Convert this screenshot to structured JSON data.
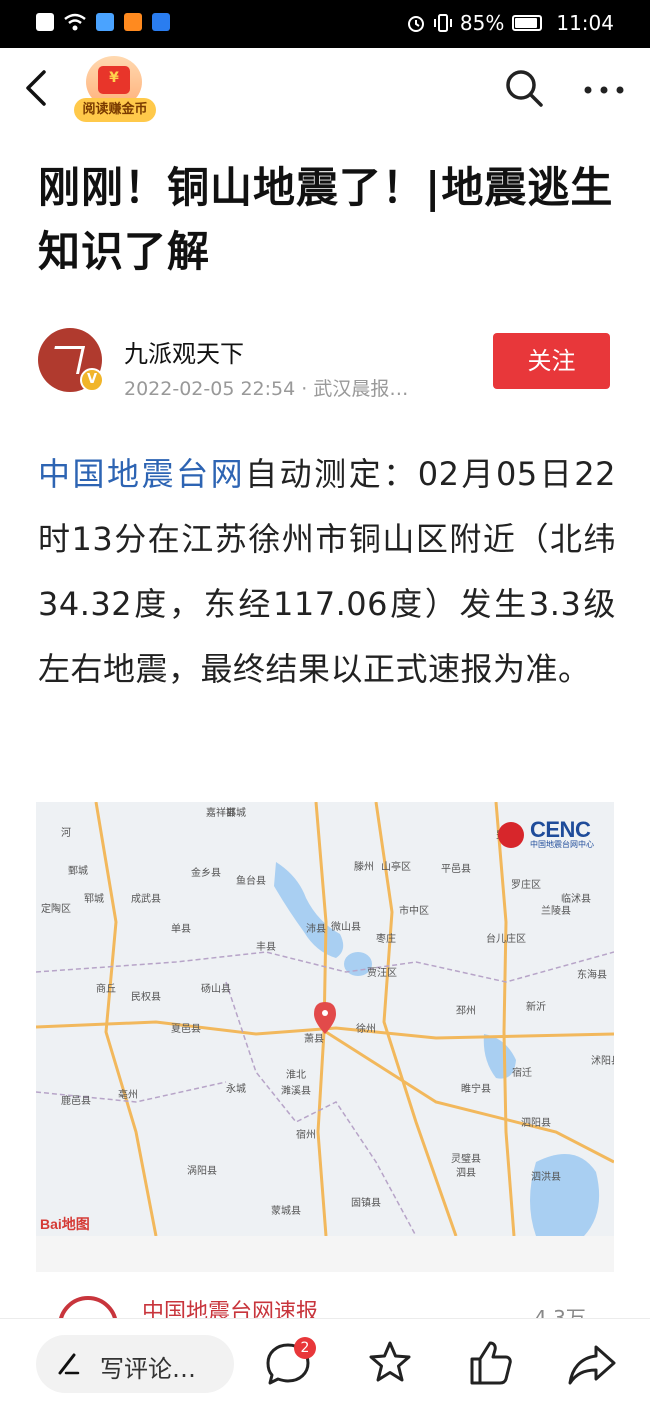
{
  "status_bar": {
    "battery": "85%",
    "time": "11:04"
  },
  "nav": {
    "coin_badge_label": "阅读赚金币"
  },
  "article": {
    "title": "刚刚！铜山地震了！|地震逃生知识了解",
    "author_name": "九派观天下",
    "author_meta": "2022-02-05 22:54 · 武汉晨报…",
    "follow_label": "关注",
    "body_link": "中国地震台网",
    "body_text": "自动测定：02月05日22时13分在江苏徐州市铜山区附近（北纬34.32度，东经117.06度）发生3.3级左右地震，最终结果以正式速报为准。"
  },
  "map": {
    "logo_text": "CENC",
    "logo_subtext": "中国地震台网中心",
    "provider": "Bai地图",
    "places": [
      "邯城",
      "嘉祥县",
      "费县",
      "河",
      "鄄城",
      "郓城",
      "滕州",
      "山亭区",
      "平邑县",
      "罗庄区",
      "临沭县",
      "定陶区",
      "金乡县",
      "鱼台县",
      "成武县",
      "市中区",
      "兰陵县",
      "单县",
      "微山县",
      "枣庄",
      "沛县",
      "丰县",
      "台儿庄区",
      "东海县",
      "商丘",
      "民权县",
      "砀山县",
      "贾汪区",
      "新沂",
      "邳州",
      "夏邑县",
      "萧县",
      "徐州",
      "宿迁",
      "沭阳县",
      "永城",
      "淮北",
      "濉溪县",
      "睢宁县",
      "泗阳县",
      "鹿邑县",
      "亳州",
      "宿州",
      "灵璧县",
      "泗洪县",
      "泗县",
      "涡阳县",
      "蒙城县",
      "固镇县"
    ]
  },
  "related": {
    "title": "中国地震台网速报",
    "count": "4.3万"
  },
  "bottom_bar": {
    "comment_placeholder": "写评论…",
    "comment_count": "2"
  },
  "colors": {
    "follow_button": "#e8373a",
    "link": "#2d64b3",
    "quake_marker": "#e24a4a"
  }
}
